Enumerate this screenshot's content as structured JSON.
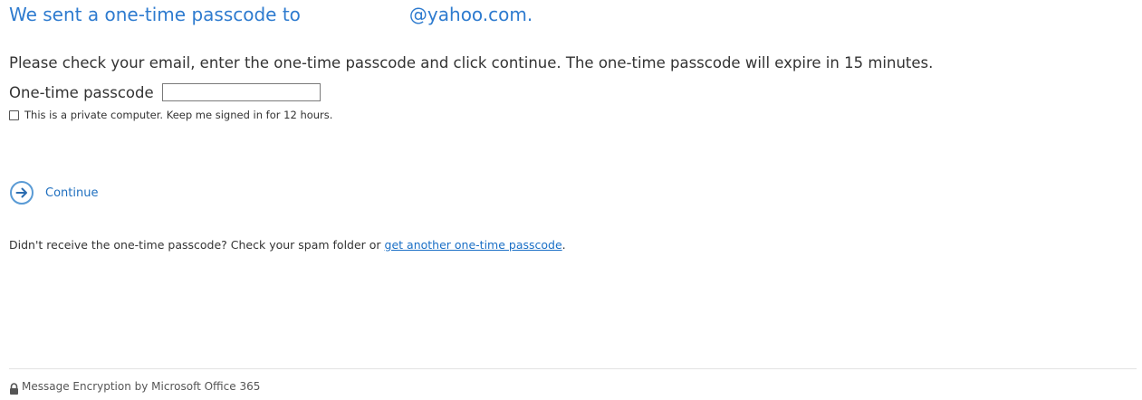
{
  "heading": {
    "sent_text": "We sent a one-time passcode to",
    "email_domain": "@yahoo.com."
  },
  "instructions": "Please check your email, enter the one-time passcode and click continue. The one-time passcode will expire in 15 minutes.",
  "passcode": {
    "label": "One-time passcode",
    "value": "",
    "placeholder": ""
  },
  "keep_signed_in": {
    "label": "This is a private computer. Keep me signed in for 12 hours.",
    "checked": false
  },
  "continue": {
    "label": "Continue",
    "icon": "arrow-right-circle-icon"
  },
  "resend": {
    "prefix": "Didn't receive the one-time passcode? Check your spam folder or ",
    "link_text": "get another one-time passcode",
    "suffix": "."
  },
  "footer": {
    "icon": "lock-icon",
    "text": "Message Encryption by Microsoft Office 365"
  },
  "colors": {
    "heading": "#2e7bcf",
    "link": "#1a6fc6",
    "icon_accent": "#5a9bd5"
  }
}
